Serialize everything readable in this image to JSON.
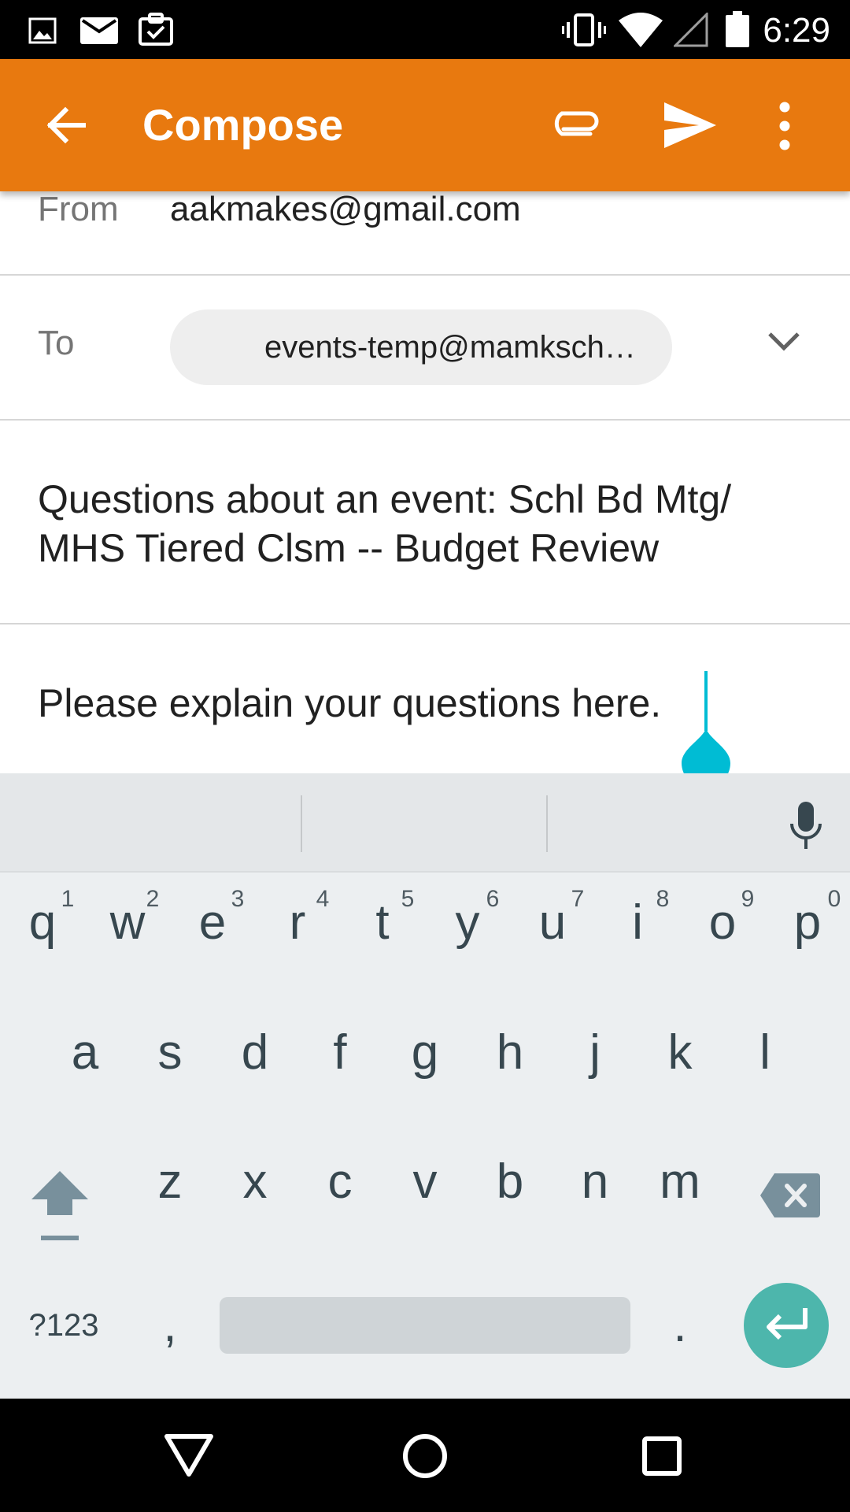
{
  "status_bar": {
    "time": "6:29",
    "left_icons": [
      "image-icon",
      "mail-icon",
      "clipboard-check-icon"
    ],
    "right_icons": [
      "vibrate-icon",
      "wifi-icon",
      "signal-icon",
      "battery-icon"
    ]
  },
  "app_bar": {
    "title": "Compose",
    "background_color": "#e8790f",
    "icons": [
      "back-arrow-icon",
      "paperclip-icon",
      "send-icon",
      "more-vert-icon"
    ]
  },
  "compose": {
    "from_label": "From",
    "from_value": "aakmakes@gmail.com",
    "to_label": "To",
    "to_chip": "events-temp@mamksch…",
    "subject": "Questions about an event: Schl Bd Mtg/ MHS Tiered Clsm -- Budget Review",
    "body": "Please explain your questions here.",
    "cursor_color": "#00bcd4"
  },
  "keyboard": {
    "row1": [
      "q",
      "w",
      "e",
      "r",
      "t",
      "y",
      "u",
      "i",
      "o",
      "p"
    ],
    "row1_hints": [
      "1",
      "2",
      "3",
      "4",
      "5",
      "6",
      "7",
      "8",
      "9",
      "0"
    ],
    "row2": [
      "a",
      "s",
      "d",
      "f",
      "g",
      "h",
      "j",
      "k",
      "l"
    ],
    "row3": [
      "z",
      "x",
      "c",
      "v",
      "b",
      "n",
      "m"
    ],
    "symbols_key": "?123",
    "comma_key": ",",
    "period_key": ".",
    "enter_color": "#4db6ac",
    "icons": [
      "mic-icon",
      "shift-icon",
      "backspace-icon",
      "enter-icon"
    ]
  },
  "nav_bar": {
    "icons": [
      "back-triangle-icon",
      "home-circle-icon",
      "recents-square-icon"
    ]
  }
}
